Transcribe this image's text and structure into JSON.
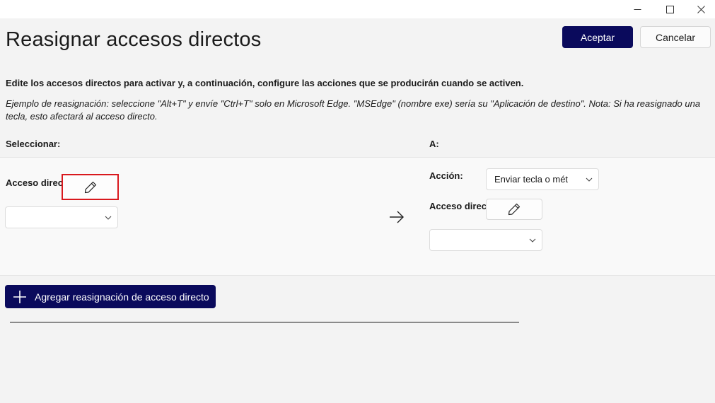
{
  "window": {
    "minimize_icon": "minimize-icon",
    "maximize_icon": "maximize-icon",
    "close_icon": "close-icon"
  },
  "header": {
    "title": "Reasignar accesos directos",
    "accept_label": "Aceptar",
    "cancel_label": "Cancelar"
  },
  "instructions": "Edite los accesos directos para activar y, a continuación, configure las acciones que se producirán cuando se activen.",
  "example": "Ejemplo de reasignación: seleccione \"Alt+T\" y envíe \"Ctrl+T\" solo en Microsoft Edge. \"MSEdge\" (nombre exe) sería su \"Aplicación de destino\". Nota: Si ha reasignado una tecla, esto afectará al acceso directo.",
  "columns": {
    "select_label": "Seleccionar:",
    "to_label": "A:"
  },
  "mapping": {
    "source": {
      "shortcut_label": "Acceso directo",
      "shortcut_value": ""
    },
    "target": {
      "action_label": "Acción:",
      "action_value": "Enviar tecla o mét",
      "shortcut_label": "Acceso directo",
      "shortcut_value": ""
    }
  },
  "add_button_label": "Agregar reasignación de acceso directo",
  "colors": {
    "accent": "#0a0a5c",
    "highlight": "#d9191e",
    "background": "#f3f3f3"
  }
}
